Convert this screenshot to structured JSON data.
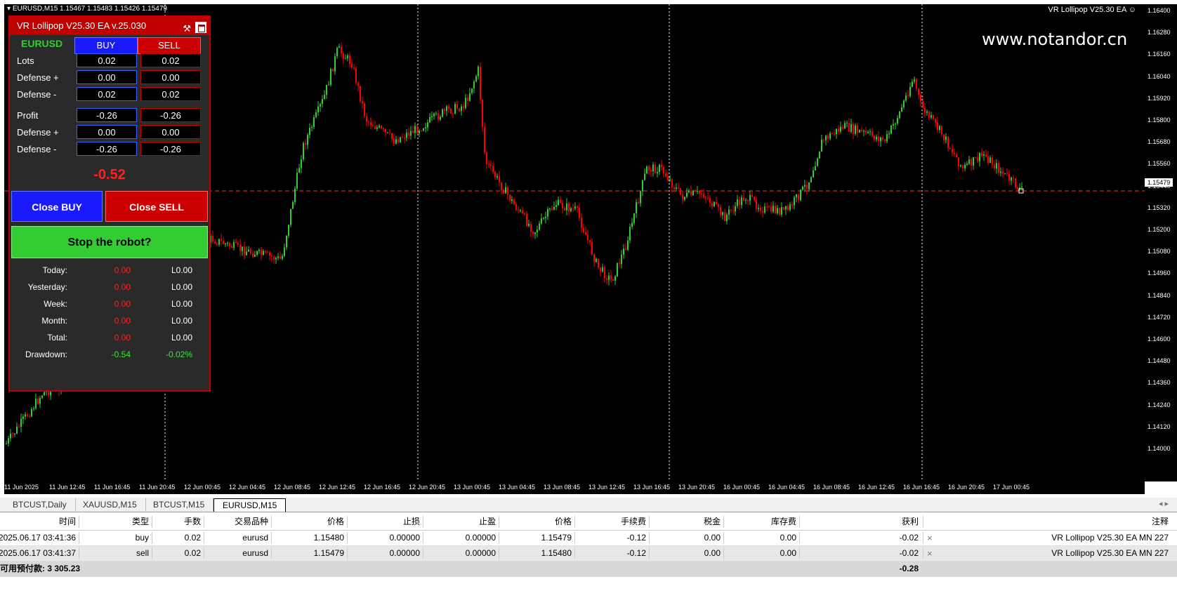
{
  "chart": {
    "symbol_info": "EURUSD,M15  1.15467 1.15483 1.15426 1.15479",
    "ea_label": "VR Lollipop V25.30 EA",
    "watermark": "www.notandor.cn",
    "current_price": "1.15479",
    "y_ticks": [
      "1.16400",
      "1.16280",
      "1.16160",
      "1.16040",
      "1.15920",
      "1.15800",
      "1.15680",
      "1.15560",
      "1.15440",
      "1.15320",
      "1.15200",
      "1.15080",
      "1.14960",
      "1.14840",
      "1.14720",
      "1.14600",
      "1.14480",
      "1.14360",
      "1.14240",
      "1.14120",
      "1.14000"
    ],
    "x_ticks": [
      "11 Jun 2025",
      "11 Jun 12:45",
      "11 Jun 16:45",
      "11 Jun 20:45",
      "12 Jun 00:45",
      "12 Jun 04:45",
      "12 Jun 08:45",
      "12 Jun 12:45",
      "12 Jun 16:45",
      "12 Jun 20:45",
      "13 Jun 00:45",
      "13 Jun 04:45",
      "13 Jun 08:45",
      "13 Jun 12:45",
      "13 Jun 16:45",
      "13 Jun 20:45",
      "16 Jun 00:45",
      "16 Jun 04:45",
      "16 Jun 08:45",
      "16 Jun 12:45",
      "16 Jun 16:45",
      "16 Jun 20:45",
      "17 Jun 00:45"
    ],
    "colors": {
      "bull": "#33cc33",
      "bear": "#ff0000",
      "background": "#000000",
      "price_line": "#ff3333"
    }
  },
  "panel": {
    "title": "VR Lollipop V25.30 EA v.25.030",
    "symbol": "EURUSD",
    "buy_label": "BUY",
    "sell_label": "SELL",
    "rows1": [
      {
        "label": "Lots",
        "buy": "0.02",
        "sell": "0.02"
      },
      {
        "label": "Defense +",
        "buy": "0.00",
        "sell": "0.00"
      },
      {
        "label": "Defense -",
        "buy": "0.02",
        "sell": "0.02"
      }
    ],
    "rows2": [
      {
        "label": "Profit",
        "buy": "-0.26",
        "sell": "-0.26"
      },
      {
        "label": "Defense +",
        "buy": "0.00",
        "sell": "0.00"
      },
      {
        "label": "Defense -",
        "buy": "-0.26",
        "sell": "-0.26"
      }
    ],
    "total_profit": "-0.52",
    "close_buy": "Close BUY",
    "close_sell": "Close SELL",
    "stop": "Stop the robot?",
    "stats": [
      {
        "label": "Today:",
        "value": "0.00",
        "ccy": "L0.00"
      },
      {
        "label": "Yesterday:",
        "value": "0.00",
        "ccy": "L0.00"
      },
      {
        "label": "Week:",
        "value": "0.00",
        "ccy": "L0.00"
      },
      {
        "label": "Month:",
        "value": "0.00",
        "ccy": "L0.00"
      },
      {
        "label": "Total:",
        "value": "0.00",
        "ccy": "L0.00"
      }
    ],
    "drawdown": {
      "label": "Drawdown:",
      "value": "-0.54",
      "pct": "-0.02%"
    }
  },
  "tabs": [
    "BTCUST,Daily",
    "XAUUSD,M15",
    "BTCUST,M15",
    "EURUSD,M15"
  ],
  "tab_arrows": "◂  ▸",
  "trade_table": {
    "headers": [
      "时间",
      "类型",
      "手数",
      "交易品种",
      "价格",
      "止损",
      "止盈",
      "价格",
      "手续费",
      "税金",
      "库存费",
      "获利",
      "注释"
    ],
    "rows": [
      [
        "2025.06.17 03:41:36",
        "buy",
        "0.02",
        "eurusd",
        "1.15480",
        "0.00000",
        "0.00000",
        "1.15479",
        "-0.12",
        "0.00",
        "0.00",
        "-0.02",
        "VR Lollipop V25.30 EA MN 227"
      ],
      [
        "2025.06.17 03:41:37",
        "sell",
        "0.02",
        "eurusd",
        "1.15479",
        "0.00000",
        "0.00000",
        "1.15480",
        "-0.12",
        "0.00",
        "0.00",
        "-0.02",
        "VR Lollipop V25.30 EA MN 227"
      ]
    ],
    "footer_label": "可用预付款: 3 305.23",
    "footer_profit": "-0.28"
  }
}
